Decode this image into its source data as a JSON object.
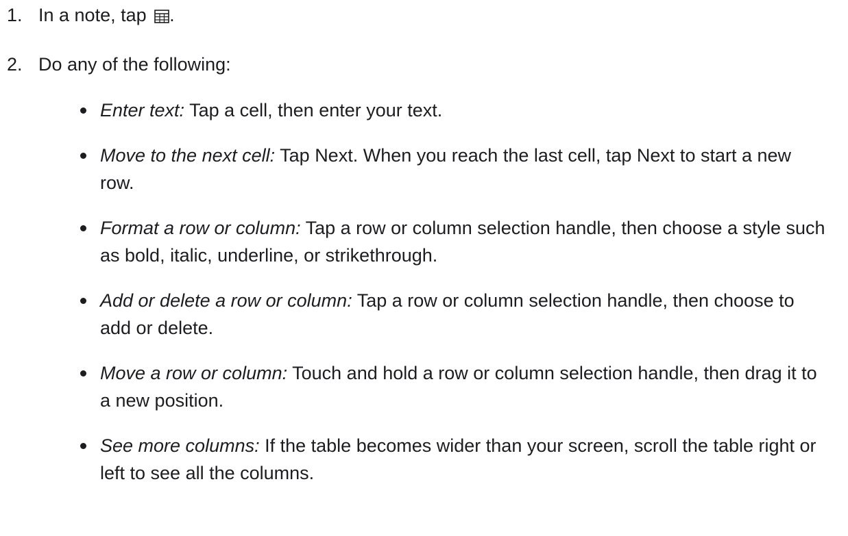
{
  "steps": [
    {
      "number": "1.",
      "text_before": "In a note, tap",
      "icon": "table-icon",
      "text_after": "."
    },
    {
      "number": "2.",
      "text": "Do any of the following:"
    }
  ],
  "bullets": [
    {
      "term": "Enter text:",
      "text": " Tap a cell, then enter your text."
    },
    {
      "term": "Move to the next cell:",
      "text": " Tap Next. When you reach the last cell, tap Next to start a new row."
    },
    {
      "term": "Format a row or column:",
      "text": " Tap a row or column selection handle, then choose a style such as bold, italic, underline, or strikethrough."
    },
    {
      "term": "Add or delete a row or column:",
      "text": " Tap a row or column selection handle, then choose to add or delete."
    },
    {
      "term": "Move a row or column:",
      "text": " Touch and hold a row or column selection handle, then drag it to a new position."
    },
    {
      "term": "See more columns:",
      "text": " If the table becomes wider than your screen, scroll the table right or left to see all the columns."
    }
  ]
}
